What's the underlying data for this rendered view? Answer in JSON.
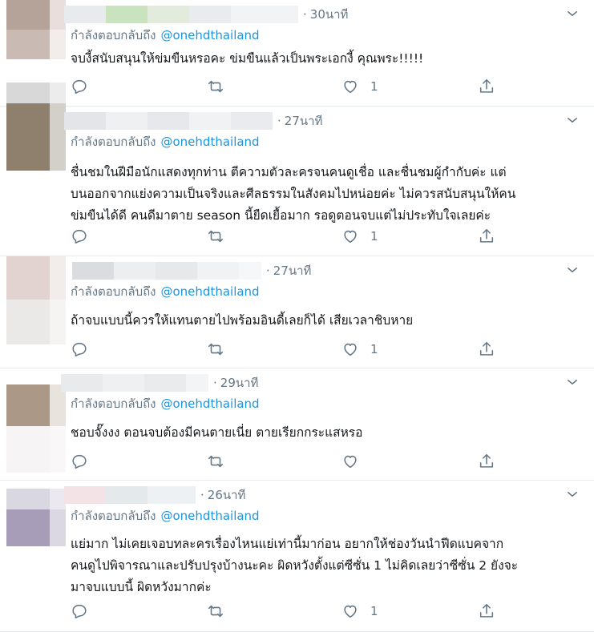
{
  "colors": {
    "text": "#14171a",
    "muted": "#657786",
    "link": "#1b95e0",
    "divider": "#e6ecf0",
    "icon": "#657786"
  },
  "tweets": [
    {
      "time": "30นาที",
      "reply_prefix": "กำลังตอบกลับถึง",
      "reply_handle": "@onehdthailand",
      "lines": [
        "จบงี้สนับสนุนให้ข่มขืนหรอคะ ข่มขืนแล้วเป็นพระเอกงี้ คุณพระ!!!!!"
      ],
      "likes": "1",
      "icons": [
        "reply-icon",
        "retweet-icon",
        "like-icon",
        "share-icon"
      ]
    },
    {
      "time": "27นาที",
      "reply_prefix": "กำลังตอบกลับถึง",
      "reply_handle": "@onehdthailand",
      "lines": [
        "ชื่นชมในฝีมือนักแสดงทุกท่าน ตีความตัวละครจนคนดูเชื่อ และชื่นชมผู้กำกับค่ะ แต่",
        "บนออกจากแย่งความเป็นจริงและศีลธรรมในสังคมไปหน่อยค่ะ ไม่ควรสนับสนุนให้คน",
        "ข่มขืนได้ดี คนดีมาตาย season นี้ยืดเยื้อมาก รอดูตอนจบแต่ไม่ประทับใจเลยค่ะ"
      ],
      "likes": "1",
      "icons": [
        "reply-icon",
        "retweet-icon",
        "like-icon",
        "share-icon"
      ]
    },
    {
      "time": "27นาที",
      "reply_prefix": "กำลังตอบกลับถึง",
      "reply_handle": "@onehdthailand",
      "lines": [
        "ถ้าจบแบบนี้ควรให้แทนตายไปพร้อมอินดี้เลยก็ได้ เสียเวลาชิบหาย"
      ],
      "likes": "1",
      "icons": [
        "reply-icon",
        "retweet-icon",
        "like-icon",
        "share-icon"
      ]
    },
    {
      "time": "29นาที",
      "reply_prefix": "กำลังตอบกลับถึง",
      "reply_handle": "@onehdthailand",
      "lines": [
        "ชอบจั๊งงง ตอนจบต้องมีคนตายเนี่ย ตายเรียกกระแสหรอ"
      ],
      "likes": "",
      "icons": [
        "reply-icon",
        "retweet-icon",
        "like-icon",
        "share-icon"
      ]
    },
    {
      "time": "26นาที",
      "reply_prefix": "กำลังตอบกลับถึง",
      "reply_handle": "@onehdthailand",
      "lines": [
        "แย่มาก ไม่เคยเจอบทละครเรื่องไหนแย่เท่านี้มาก่อน อยากให้ช่องวันนำฟีดแบคจาก",
        "คนดูไปพิจารณาและปรับปรุงบ้างนะคะ ผิดหวังตั้งแต่ซีซั่น 1 ไม่คิดเลยว่าซีซั่น 2 ยังจะ",
        "มาจบแบบนี้ ผิดหวังมากค่ะ"
      ],
      "likes": "1",
      "icons": [
        "reply-icon",
        "retweet-icon",
        "like-icon",
        "share-icon"
      ]
    }
  ]
}
